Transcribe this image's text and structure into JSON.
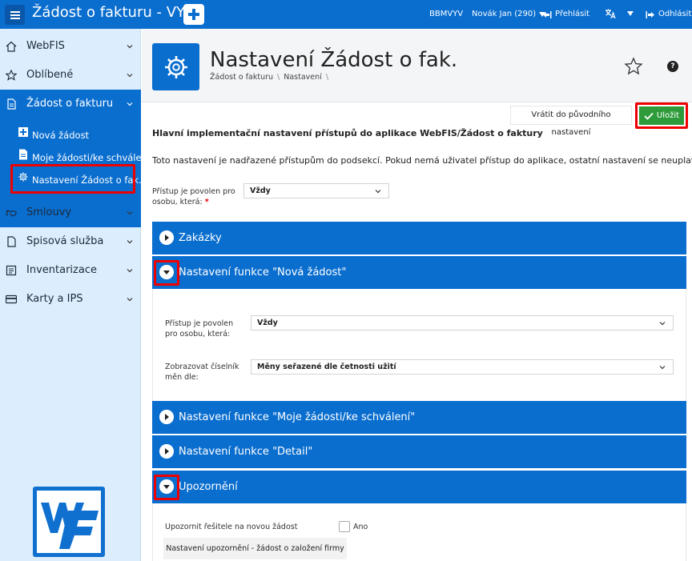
{
  "topbar": {
    "app_title": "Žádost o fakturu - VYV",
    "org": "BBMVYV",
    "user": "Novák Jan (290)",
    "login_label": "Přehlásit",
    "logout_label": "Odhlásit"
  },
  "sidebar": {
    "items": [
      {
        "label": "WebFIS",
        "icon": "home-icon"
      },
      {
        "label": "Oblíbené",
        "icon": "star-icon"
      },
      {
        "label": "Žádost o fakturu",
        "icon": "document-icon"
      },
      {
        "label": "Smlouvy",
        "icon": "handshake-icon"
      },
      {
        "label": "Spisová služba",
        "icon": "file-icon"
      },
      {
        "label": "Inventarizace",
        "icon": "inventory-icon"
      },
      {
        "label": "Karty a IPS",
        "icon": "card-icon"
      }
    ],
    "subitems": [
      {
        "label": "Nová žádost",
        "icon": "plus-icon"
      },
      {
        "label": "Moje žádosti/ke schválení",
        "icon": "document-icon"
      },
      {
        "label": "Nastavení Žádost o fak.",
        "icon": "gear-icon"
      }
    ]
  },
  "header": {
    "title": "Nastavení Žádost o fak.",
    "breadcrumb": [
      "Žádost o fakturu",
      "Nastavení"
    ]
  },
  "toolbar": {
    "reset_label": "Vrátit do původního nastavení",
    "save_label": "Uložit"
  },
  "main": {
    "section_title": "Hlavní implementační nastavení přístupů do aplikace WebFIS/Žádost o faktury",
    "description": "Toto nastavení je nadřazené přístupům do podsekcí. Pokud nemá uživatel přístup do aplikace, ostatní nastavení se neuplatní.",
    "access_label_1": "Přístup je povolen pro",
    "access_label_2": "osobu, která:",
    "access_value": "Vždy"
  },
  "accordions": {
    "zakazky": "Zakázky",
    "nova": "Nastavení funkce \"Nová žádost\"",
    "moje": "Nastavení funkce \"Moje žádosti/ke schválení\"",
    "detail": "Nastavení funkce \"Detail\"",
    "upozorneni": "Upozornění"
  },
  "nova_panel": {
    "access_label_1": "Přístup je povolen",
    "access_label_2": "pro osobu, která:",
    "access_value": "Vždy",
    "currency_label_1": "Zobrazovat číselník",
    "currency_label_2": "měn dle:",
    "currency_value": "Měny seřazené dle četnosti užití"
  },
  "upozorneni_panel": {
    "notify_label": "Upozornit řešitele na novou žádost",
    "notify_checkbox_label": "Ano",
    "notify_button_label": "Nastavení upozornění - žádost o založení firmy"
  },
  "colors": {
    "primary": "#0a6ecf",
    "sidebar_bg": "#dceefd",
    "save_green": "#2e9b3a",
    "highlight_red": "#ee0000"
  }
}
